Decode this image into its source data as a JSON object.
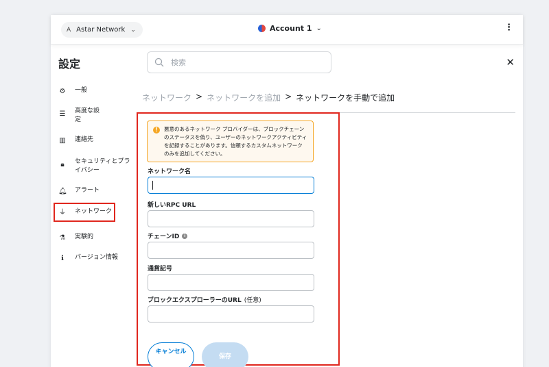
{
  "header": {
    "network": {
      "avatar_letter": "A",
      "label": "Astar Network"
    },
    "account": {
      "label": "Account 1"
    }
  },
  "settings": {
    "title": "設定",
    "search": {
      "placeholder": "検索"
    }
  },
  "sidebar": {
    "items": [
      {
        "label": "一般",
        "icon": "gear-icon"
      },
      {
        "label": "高度な設定",
        "icon": "sliders-icon"
      },
      {
        "label": "連絡先",
        "icon": "book-icon"
      },
      {
        "label": "セキュリティとプライバシー",
        "icon": "lock-icon"
      },
      {
        "label": "アラート",
        "icon": "bell-icon"
      },
      {
        "label": "ネットワーク",
        "icon": "plug-icon"
      },
      {
        "label": "実験的",
        "icon": "flask-icon"
      },
      {
        "label": "バージョン情報",
        "icon": "info-icon"
      }
    ]
  },
  "breadcrumb": {
    "items": [
      "ネットワーク",
      "ネットワークを追加"
    ],
    "separator": ">",
    "current": "ネットワークを手動で追加"
  },
  "form": {
    "warning": "悪意のあるネットワーク プロバイダーは、ブロックチェーンのステータスを偽り、ユーザーのネットワークアクティビティを記録することがあります。信頼するカスタムネットワークのみを追加してください。",
    "fields": [
      {
        "label": "ネットワーク名",
        "value": ""
      },
      {
        "label": "新しいRPC URL",
        "value": ""
      },
      {
        "label": "チェーンID",
        "value": ""
      },
      {
        "label": "通貨記号",
        "value": ""
      },
      {
        "label": "ブロックエクスプローラーのURL",
        "optional": "(任意)",
        "value": ""
      }
    ],
    "cancel_label": "キャンセル",
    "save_label": "保存"
  },
  "colors": {
    "accent": "#037dd6",
    "highlight": "#e0261d",
    "warning": "#f5a623"
  }
}
